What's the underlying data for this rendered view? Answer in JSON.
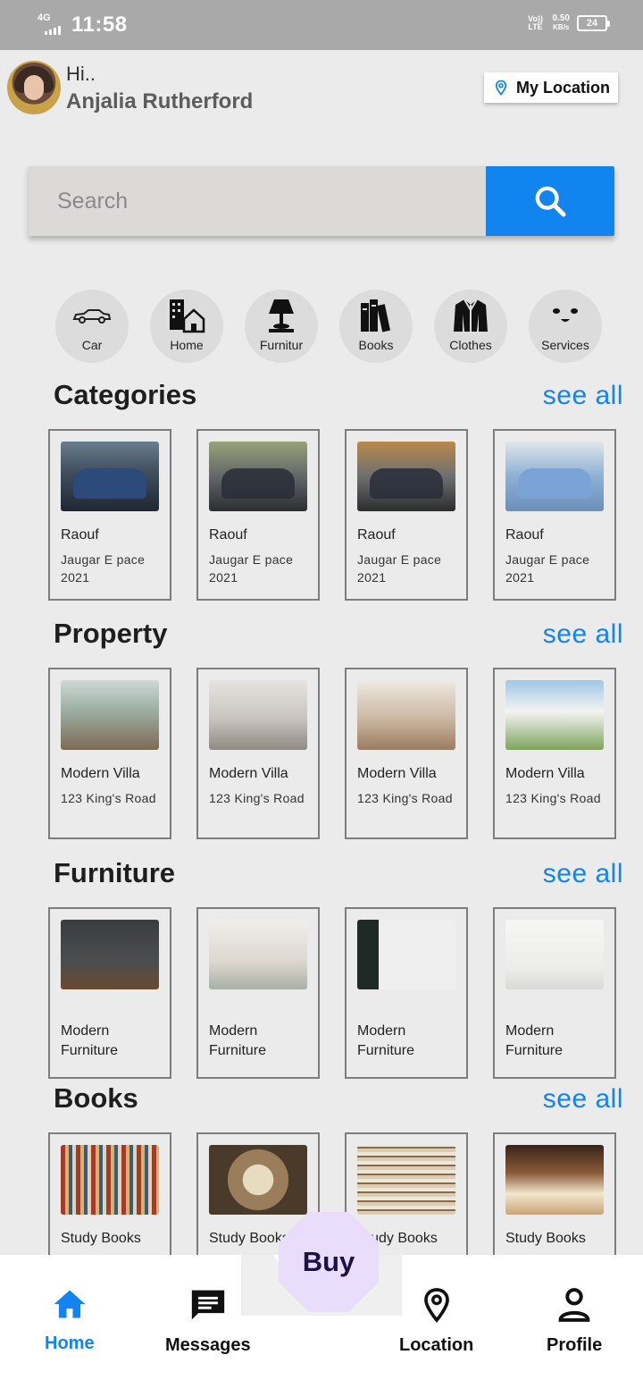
{
  "status_bar": {
    "network": "4G",
    "time": "11:58",
    "volte": "Vo)) LTE",
    "speed_value": "0.50",
    "speed_unit": "KB/s",
    "battery": "24"
  },
  "header": {
    "greeting": "Hi..",
    "user_name": "Anjalia Rutherford",
    "location_button": "My Location"
  },
  "search": {
    "placeholder": "Search"
  },
  "category_icons": [
    {
      "label": "Car",
      "icon": "car-icon"
    },
    {
      "label": "Home",
      "icon": "building-home-icon"
    },
    {
      "label": "Furnitur",
      "icon": "lamp-icon"
    },
    {
      "label": "Books",
      "icon": "books-icon"
    },
    {
      "label": "Clothes",
      "icon": "jacket-icon"
    },
    {
      "label": "Services",
      "icon": "face-icon"
    }
  ],
  "sections": [
    {
      "title": "Categories",
      "see_all": "see all",
      "items": [
        {
          "title": "Raouf",
          "subtitle": "Jaugar E pace 2021"
        },
        {
          "title": "Raouf",
          "subtitle": "Jaugar E pace 2021"
        },
        {
          "title": "Raouf",
          "subtitle": "Jaugar E pace 2021"
        },
        {
          "title": "Raouf",
          "subtitle": "Jaugar E pace 2021"
        }
      ]
    },
    {
      "title": "Property",
      "see_all": "see all",
      "items": [
        {
          "title": "Modern Villa",
          "subtitle": "123 King's Road"
        },
        {
          "title": "Modern Villa",
          "subtitle": "123 King's Road"
        },
        {
          "title": "Modern Villa",
          "subtitle": "123 King's Road"
        },
        {
          "title": "Modern Villa",
          "subtitle": "123 King's Road"
        }
      ]
    },
    {
      "title": "Furniture",
      "see_all": "see all",
      "items": [
        {
          "title": "Modern Furniture"
        },
        {
          "title": "Modern Furniture"
        },
        {
          "title": "Modern Furniture"
        },
        {
          "title": "Modern Furniture"
        }
      ]
    },
    {
      "title": "Books",
      "see_all": "see all",
      "items": [
        {
          "title": "Study Books"
        },
        {
          "title": "Study Books"
        },
        {
          "title": "Study Books"
        },
        {
          "title": "Study Books"
        }
      ]
    }
  ],
  "bottom_nav": {
    "items": [
      {
        "label": "Home",
        "icon": "home-icon",
        "active": true
      },
      {
        "label": "Messages",
        "icon": "message-icon",
        "active": false
      },
      {
        "label": "Location",
        "icon": "location-pin-icon",
        "active": false
      },
      {
        "label": "Profile",
        "icon": "person-icon",
        "active": false
      }
    ],
    "fab_label": "Buy"
  },
  "colors": {
    "accent": "#1184f0",
    "background": "#ebebeb",
    "fab": "#e9ddfb"
  }
}
